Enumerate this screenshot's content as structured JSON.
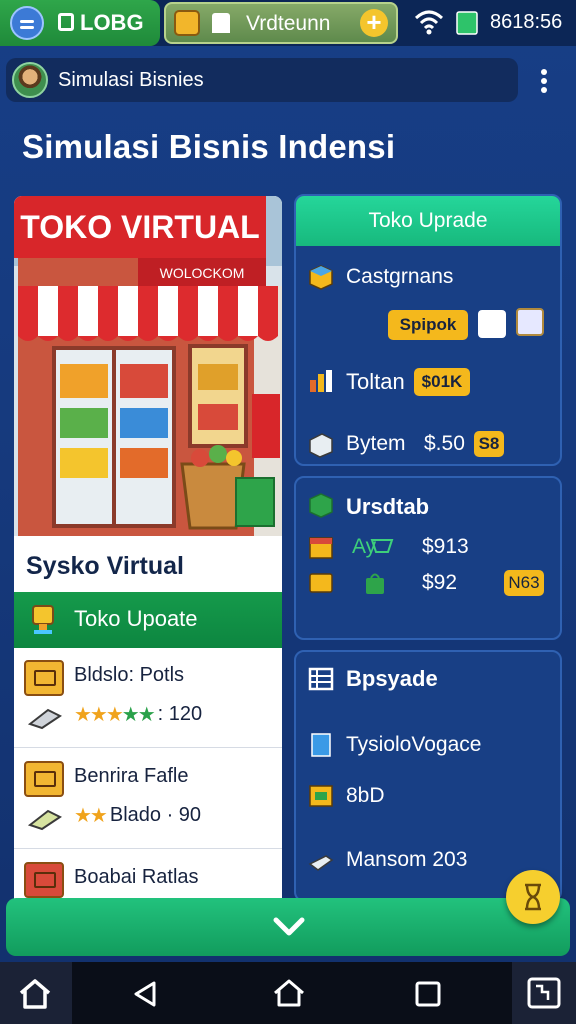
{
  "status_bar": {
    "logo_text": "LOBG",
    "tab_text": "Vrdteunn",
    "time": "8618:56"
  },
  "app_bar": {
    "title": "Simulasi Bisnies"
  },
  "page": {
    "title": "Simulasi Bisnis Indensi"
  },
  "shop_card": {
    "sign_main": "TOKO VIRTUAL",
    "sign_sub": "WOLOCKOM",
    "name": "Sysko Virtual",
    "header_label": "Toko Upoate",
    "rows": [
      {
        "title": "Bldslo: Potls",
        "sub": "120",
        "stars": "★★★",
        "stars_green": "★★"
      },
      {
        "title": "Benrira Fafle",
        "sub": "Blado · 90",
        "stars": "★★",
        "stars_green": ""
      },
      {
        "title": "Boabai Ratlas",
        "sub": "",
        "stars": "",
        "stars_green": ""
      }
    ]
  },
  "panel_upgrade": {
    "title": "Toko Uprade",
    "item1": "Castgrnans",
    "button": "Spipok",
    "total_label": "Toltan",
    "total_value": "$01K",
    "bytem_label": "Bytem",
    "bytem_value": "$.50",
    "bytem_badge": "S8"
  },
  "panel_urs": {
    "title": "Ursdtab",
    "row1_label": "Ay",
    "row1_value": "$913",
    "row2_value": "$92",
    "row2_badge": "N63"
  },
  "panel_bpsyade": {
    "title": "Bpsyade",
    "item1": "TysioloVogace",
    "item2": "8bD",
    "item3": "Mansom 203"
  },
  "colors": {
    "background": "#163a7e",
    "accent_green": "#17b97d",
    "badge_yellow": "#f4b81c",
    "shop_header_green": "#0d8640"
  },
  "icons": {
    "status": [
      "menu-icon",
      "logo-icon",
      "game-icon",
      "chef-hat-icon",
      "plus-icon",
      "wifi-icon",
      "battery-icon"
    ],
    "nav": [
      "home-icon",
      "back-icon",
      "home-outline-icon",
      "recents-icon",
      "screenshot-icon"
    ]
  }
}
